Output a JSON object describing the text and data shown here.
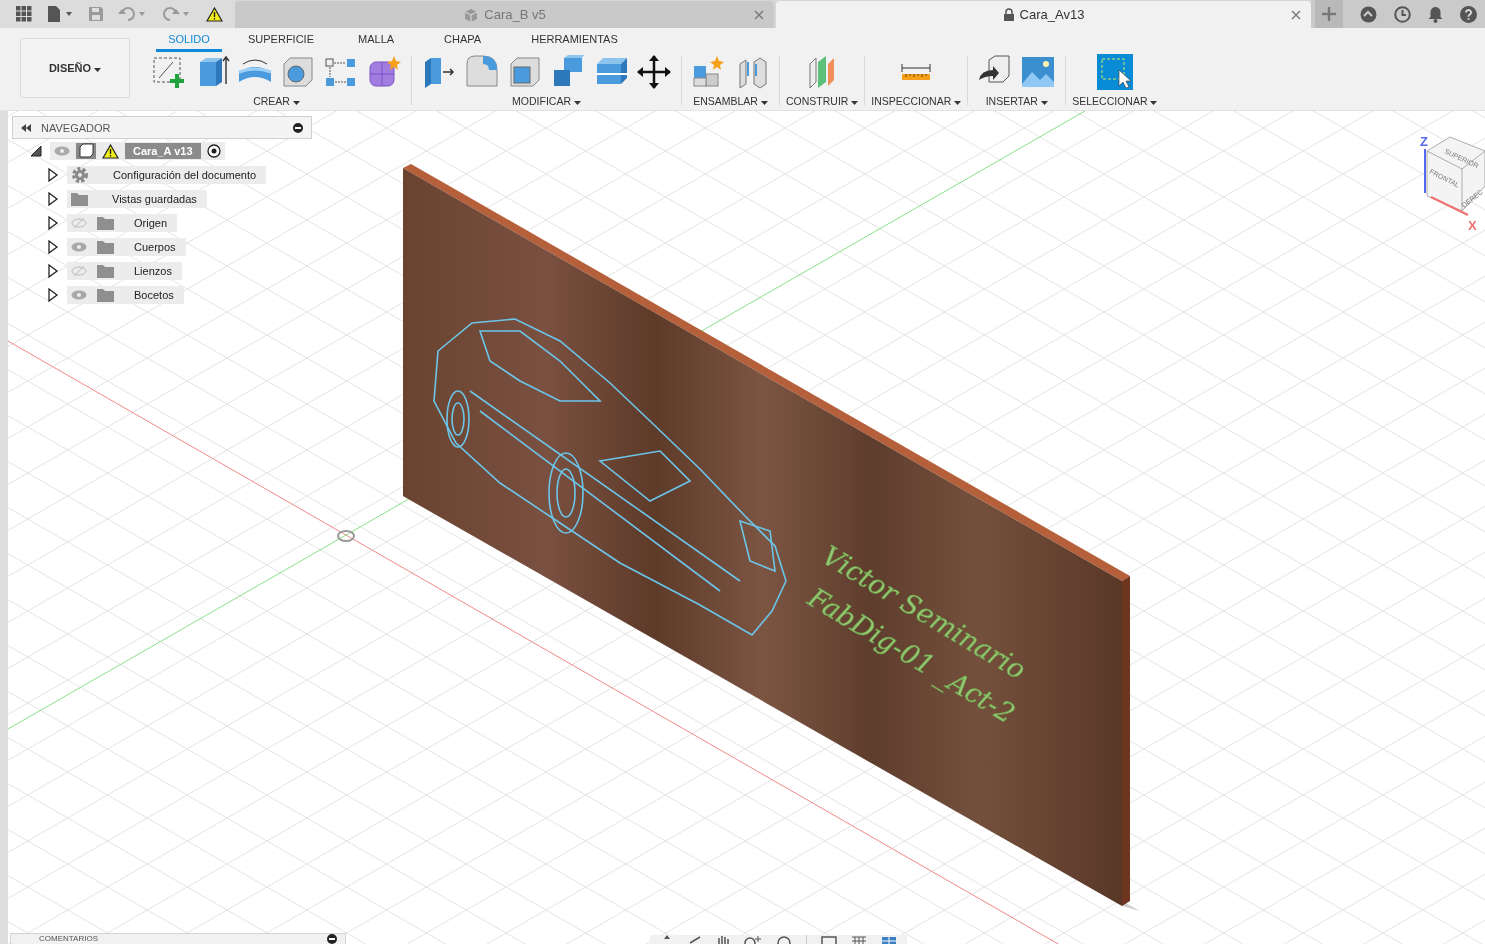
{
  "app_bar": {
    "document_tabs": [
      {
        "label": "Cara_B v5",
        "selected": false
      },
      {
        "label": "Cara_Av13",
        "selected": true
      }
    ]
  },
  "toolbar": {
    "workspace": "DISEÑO",
    "tabs": [
      {
        "label": "SOLIDO",
        "selected": true
      },
      {
        "label": "SUPERFICIE",
        "selected": false
      },
      {
        "label": "MALLA",
        "selected": false
      },
      {
        "label": "CHAPA",
        "selected": false
      },
      {
        "label": "HERRAMIENTAS",
        "selected": false
      }
    ],
    "groups": [
      {
        "label": "CREAR",
        "tools": [
          {
            "kind": "sketch"
          },
          {
            "kind": "extrude"
          },
          {
            "kind": "revolve"
          },
          {
            "kind": "hole"
          },
          {
            "kind": "pattern"
          },
          {
            "kind": "form"
          }
        ]
      },
      {
        "label": "MODIFICAR",
        "tools": [
          {
            "kind": "press_pull"
          },
          {
            "kind": "fillet"
          },
          {
            "kind": "shell"
          },
          {
            "kind": "combine"
          },
          {
            "kind": "split"
          },
          {
            "kind": "move"
          }
        ]
      },
      {
        "label": "ENSAMBLAR",
        "tools": [
          {
            "kind": "component"
          },
          {
            "kind": "joint"
          }
        ]
      },
      {
        "label": "CONSTRUIR",
        "tools": [
          {
            "kind": "plane"
          }
        ]
      },
      {
        "label": "INSPECCIONAR",
        "tools": [
          {
            "kind": "measure"
          }
        ]
      },
      {
        "label": "INSERTAR",
        "tools": [
          {
            "kind": "insert"
          },
          {
            "kind": "image"
          }
        ]
      },
      {
        "label": "SELECCIONAR",
        "tools": [
          {
            "kind": "select"
          }
        ]
      }
    ]
  },
  "navigator": {
    "title": "NAVEGADOR",
    "root": {
      "label": "Cara_A v13",
      "expanded": true,
      "visible": true,
      "children": [
        {
          "label": "Configuración del documento",
          "kind": "settings",
          "expanded": false
        },
        {
          "label": "Vistas guardadas",
          "kind": "folder",
          "expanded": false
        },
        {
          "label": "Origen",
          "kind": "folder",
          "expanded": false,
          "visible": false
        },
        {
          "label": "Cuerpos",
          "kind": "folder",
          "expanded": false,
          "visible": true
        },
        {
          "label": "Lienzos",
          "kind": "folder",
          "expanded": false,
          "visible": false
        },
        {
          "label": "Bocetos",
          "kind": "folder",
          "expanded": false,
          "visible": true
        }
      ]
    }
  },
  "viewport": {
    "engraving": [
      "Victor Seminario",
      "FabDig-01 _Act-2"
    ],
    "viewcube": {
      "top": "SUPERIOR",
      "front": "FRONTAL",
      "right": "DEREC",
      "z_axis": "Z",
      "x_axis": "X"
    }
  },
  "comments_panel": {
    "title": "COMENTARIOS"
  }
}
